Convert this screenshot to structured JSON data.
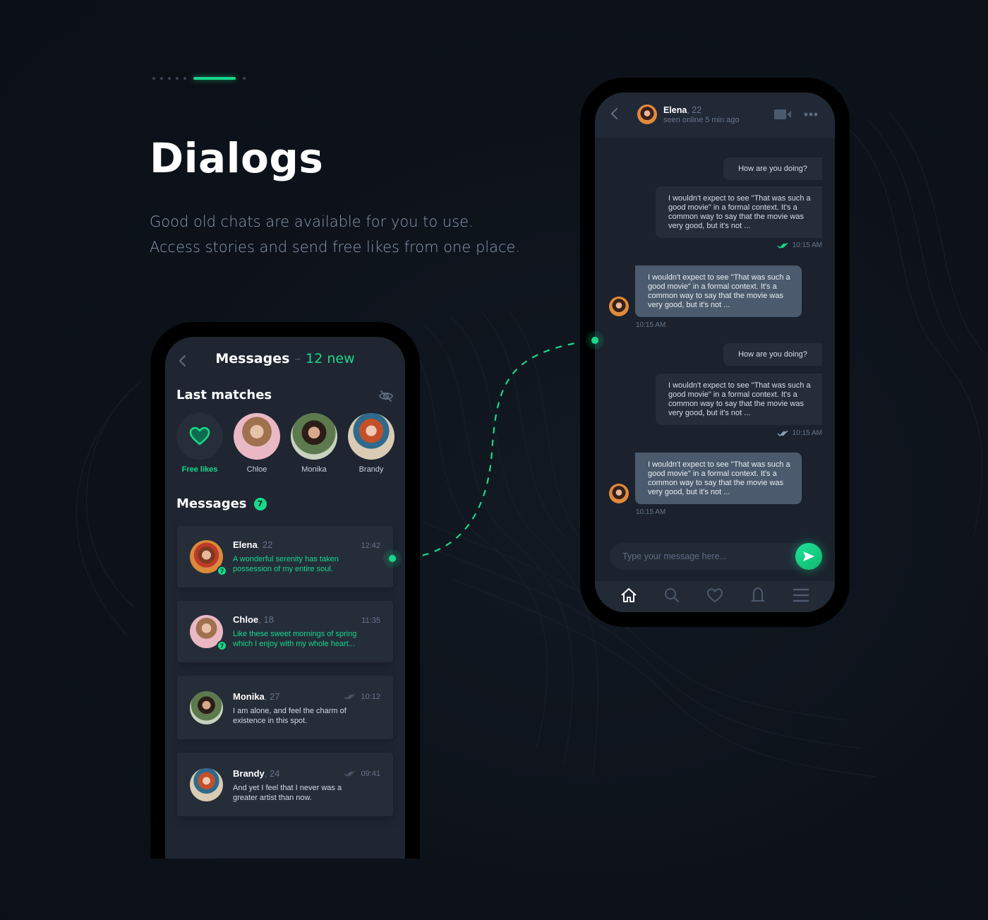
{
  "hero": {
    "title": "Dialogs",
    "subtitle_line1": "Good old chats are available for you to use.",
    "subtitle_line2": "Access stories and send free likes from one place.",
    "pager": {
      "total": 7,
      "active_index": 5
    }
  },
  "colors": {
    "accent": "#17d88b",
    "background": "#0d121a",
    "screen": "#1f2632",
    "card": "#252d39",
    "incoming_bubble": "#4b5b6d",
    "muted_text": "#66748a"
  },
  "messages_screen": {
    "back_icon": "chevron-left-icon",
    "header_title": "Messages",
    "header_separator": "–",
    "header_new": "12 new",
    "last_matches_title": "Last matches",
    "hide_icon": "eye-off-icon",
    "matches": [
      {
        "label": "Free likes",
        "icon": "heart-icon",
        "type": "free"
      },
      {
        "label": "Chloe",
        "type": "user"
      },
      {
        "label": "Monika",
        "type": "user"
      },
      {
        "label": "Brandy",
        "type": "user"
      }
    ],
    "messages_title": "Messages",
    "messages_badge": "7",
    "conversations": [
      {
        "name": "Elena",
        "age": ", 22",
        "time": "12:42",
        "preview": "A wonderful serenity has taken possession of my entire soul.",
        "unread": true,
        "badge": "7",
        "read_receipt": false
      },
      {
        "name": "Chloe",
        "age": ", 18",
        "time": "11:35",
        "preview": "Like these sweet mornings of spring which I enjoy with my whole heart...",
        "unread": true,
        "badge": "7",
        "read_receipt": false
      },
      {
        "name": "Monika",
        "age": ", 27",
        "time": "10:12",
        "preview": "I am alone, and feel the charm of existence in this spot.",
        "unread": false,
        "read_receipt": true
      },
      {
        "name": "Brandy",
        "age": ", 24",
        "time": "09:41",
        "preview": "And yet I feel that I never was a greater artist than now.",
        "unread": false,
        "read_receipt": true
      }
    ]
  },
  "chat_screen": {
    "contact_name": "Elena",
    "contact_age": ", 22",
    "contact_status": "seen online 5 min ago",
    "header_icons": [
      "chevron-left-icon",
      "video-camera-icon",
      "more-horizontal-icon"
    ],
    "messages": [
      {
        "direction": "out",
        "text": "How are you doing?"
      },
      {
        "direction": "out",
        "text": "I wouldn't expect to see \"That was such a good movie\" in a formal context. It's a common way to say that the movie was very good, but it's not ...",
        "time": "10:15 AM",
        "read": true
      },
      {
        "direction": "in",
        "text": "I wouldn't expect to see \"That was such a good movie\" in a formal context. It's a common way to say that the movie was very good, but it's not ...",
        "time": "10:15 AM"
      },
      {
        "direction": "out",
        "text": "How are you doing?"
      },
      {
        "direction": "out",
        "text": "I wouldn't expect to see \"That was such a good movie\" in a formal context. It's a common way to say that the movie was very good, but it's not ...",
        "time": "10:15 AM",
        "read": false
      },
      {
        "direction": "in",
        "text": "I wouldn't expect to see \"That was such a good movie\" in a formal context. It's a common way to say that the movie was very good, but it's not ...",
        "time": "10:15 AM"
      }
    ],
    "composer_placeholder": "Type your message here...",
    "send_icon": "send-icon",
    "tabbar": [
      {
        "icon": "home-icon",
        "active": true
      },
      {
        "icon": "search-icon",
        "active": false
      },
      {
        "icon": "heart-icon",
        "active": false
      },
      {
        "icon": "bell-icon",
        "active": false
      },
      {
        "icon": "menu-icon",
        "active": false
      }
    ]
  }
}
